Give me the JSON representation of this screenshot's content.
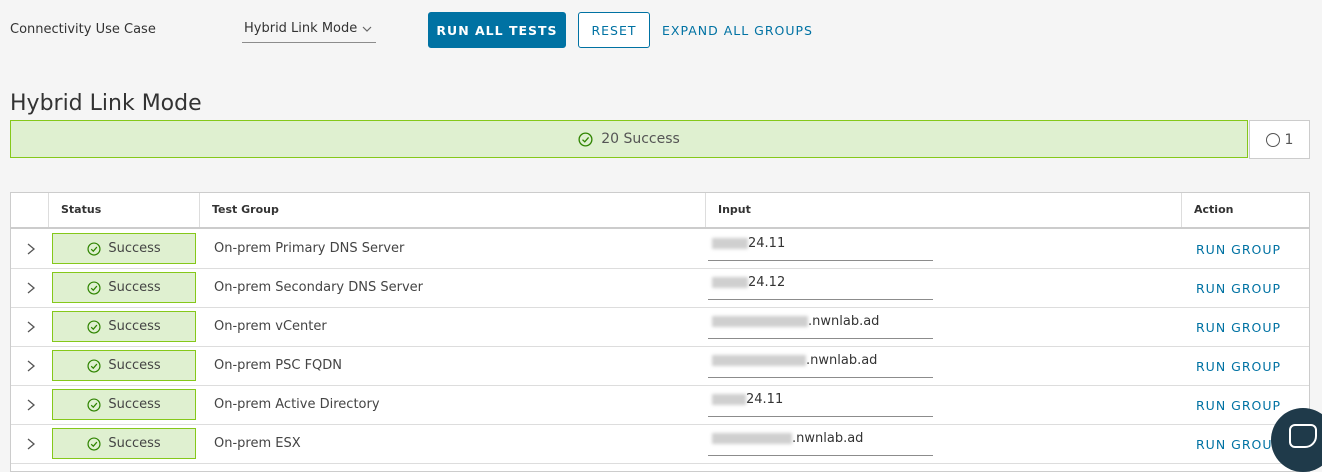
{
  "toolbar": {
    "use_case_label": "Connectivity Use Case",
    "mode_value": "Hybrid Link Mode",
    "run_all_label": "RUN ALL TESTS",
    "reset_label": "RESET",
    "expand_label": "EXPAND ALL GROUPS"
  },
  "page_title": "Hybrid Link Mode",
  "summary": {
    "success_text": "20 Success",
    "pending_count": "1"
  },
  "table": {
    "headers": {
      "status": "Status",
      "test_group": "Test Group",
      "input": "Input",
      "action": "Action"
    },
    "rows": [
      {
        "status": "Success",
        "group": "On-prem Primary DNS Server",
        "input_visible": "24.11",
        "action": "RUN GROUP"
      },
      {
        "status": "Success",
        "group": "On-prem Secondary DNS Server",
        "input_visible": "24.12",
        "action": "RUN GROUP"
      },
      {
        "status": "Success",
        "group": "On-prem vCenter",
        "input_visible": ".nwnlab.ad",
        "action": "RUN GROUP"
      },
      {
        "status": "Success",
        "group": "On-prem PSC FQDN",
        "input_visible": ".nwnlab.ad",
        "action": "RUN GROUP"
      },
      {
        "status": "Success",
        "group": "On-prem Active Directory",
        "input_visible": "24.11",
        "action": "RUN GROUP"
      },
      {
        "status": "Success",
        "group": "On-prem ESX",
        "input_visible": ".nwnlab.ad",
        "action": "RUN GROUP"
      }
    ]
  },
  "colors": {
    "accent": "#0072a3",
    "success_bg": "#dff0d0",
    "success_border": "#85c81a",
    "success_icon": "#2f8400"
  },
  "icons": {
    "mode_select": "chevron-down-icon",
    "success": "check-circle-icon",
    "pending": "circle-icon",
    "row_expander": "chevron-right-icon",
    "chat": "chat-icon"
  }
}
